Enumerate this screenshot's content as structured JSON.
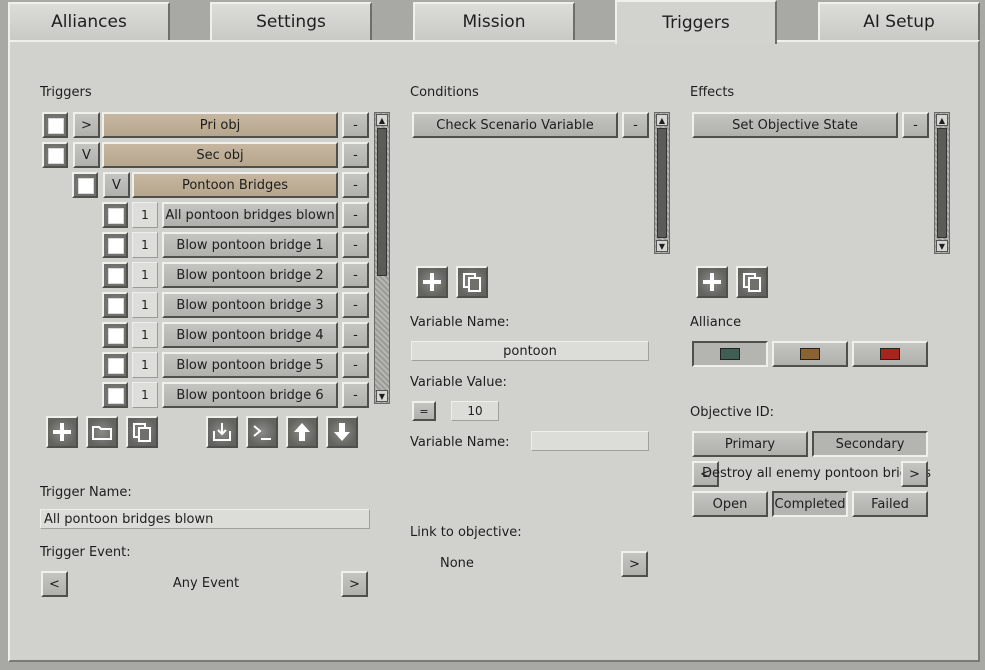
{
  "tabs": [
    "Alliances",
    "Settings",
    "Mission",
    "Triggers",
    "AI Setup"
  ],
  "triggers_section": {
    "title": "Triggers",
    "rows": [
      {
        "toggle": ">",
        "label": "Pri obj"
      },
      {
        "toggle": "V",
        "label": "Sec obj"
      },
      {
        "toggle": "V",
        "label": "Pontoon Bridges"
      },
      {
        "count": "1",
        "label": "All pontoon bridges blown"
      },
      {
        "count": "1",
        "label": "Blow pontoon bridge 1"
      },
      {
        "count": "1",
        "label": "Blow pontoon bridge 2"
      },
      {
        "count": "1",
        "label": "Blow pontoon bridge 3"
      },
      {
        "count": "1",
        "label": "Blow pontoon bridge 4"
      },
      {
        "count": "1",
        "label": "Blow pontoon bridge 5"
      },
      {
        "count": "1",
        "label": "Blow pontoon bridge 6"
      }
    ],
    "remove_label": "-",
    "trigger_name_label": "Trigger Name:",
    "trigger_name_value": "All pontoon bridges blown",
    "trigger_event_label": "Trigger Event:",
    "trigger_event_value": "Any Event",
    "prev": "<",
    "next": ">"
  },
  "conditions": {
    "title": "Conditions",
    "item": "Check Scenario Variable",
    "remove_label": "-",
    "var_name_label": "Variable Name:",
    "var_name_value": "pontoon",
    "var_value_label": "Variable Value:",
    "operator": "=",
    "var_value": "10",
    "var_name2_label": "Variable Name:",
    "var_name2_value": "",
    "link_label": "Link to objective:",
    "link_value": "None",
    "link_next": ">"
  },
  "effects": {
    "title": "Effects",
    "item": "Set Objective State",
    "remove_label": "-",
    "alliance_label": "Alliance",
    "alliance_colors": [
      "#3f5f55",
      "#8a6234",
      "#a8241c"
    ],
    "objective_id_label": "Objective ID:",
    "primary": "Primary",
    "secondary": "Secondary",
    "objective_text": "Destroy all enemy pontoon bridges",
    "obj_prev": "<",
    "obj_next": ">",
    "states": [
      "Open",
      "Completed",
      "Failed"
    ]
  },
  "colors": {
    "tan_button": "#bfae96",
    "panel": "#d1d1cd"
  }
}
